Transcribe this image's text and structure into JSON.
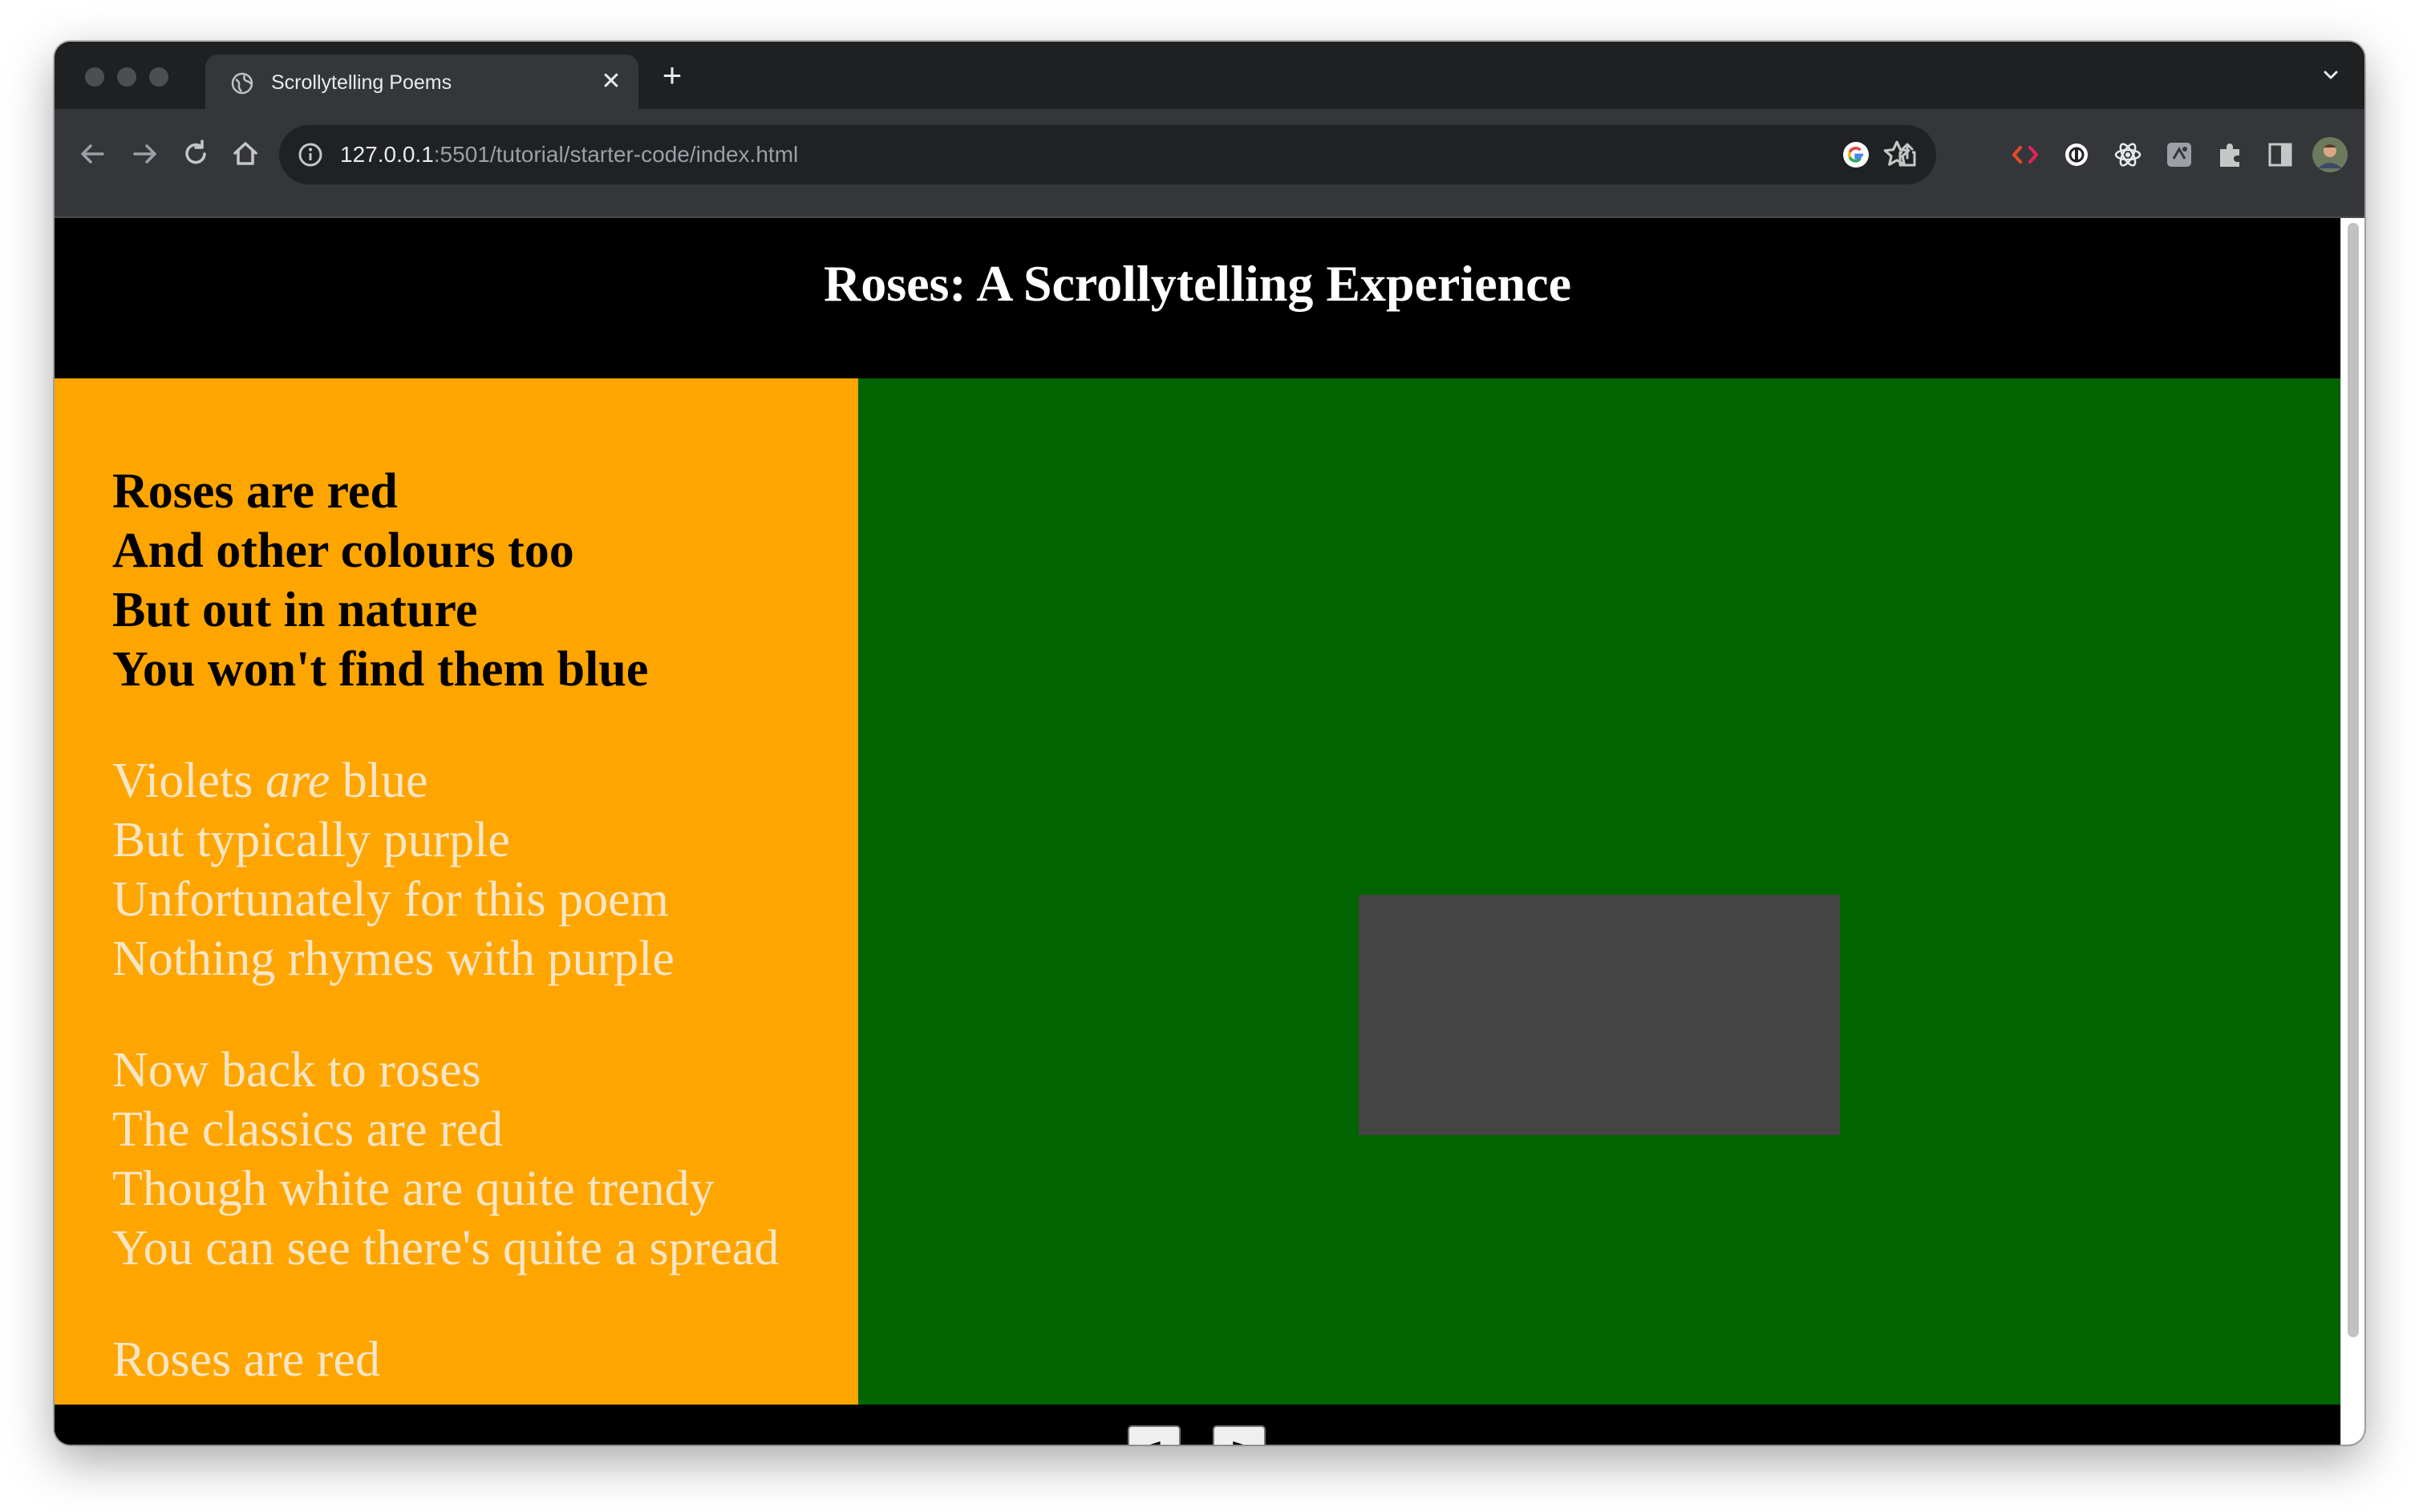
{
  "browser": {
    "tab": {
      "title": "Scrollytelling Poems",
      "close_glyph": "✕",
      "favicon": "globe-icon"
    },
    "new_tab_glyph": "+",
    "address": {
      "host": "127.0.0.1",
      "path": ":5501/tutorial/starter-code/index.html"
    },
    "toolbar_icons": [
      "back-icon",
      "forward-icon",
      "reload-icon",
      "home-icon",
      "site-info-icon",
      "google-icon",
      "share-icon",
      "bookmark-star-icon"
    ],
    "extension_icons": [
      "code-brackets-extension-icon",
      "circle-extension-icon",
      "react-devtools-icon",
      "square-extension-icon",
      "puzzle-extensions-icon",
      "side-panel-icon",
      "profile-avatar",
      "kebab-menu-icon"
    ]
  },
  "page": {
    "title": "Roses: A Scrollytelling Experience",
    "colors": {
      "header_bg": "#000000",
      "poem_panel_bg": "#ffa500",
      "viz_panel_bg": "#006400",
      "viz_rect": "#444444",
      "active_text": "#000000",
      "inactive_text": "#f5e6c6"
    },
    "stanzas": [
      {
        "active": true,
        "lines": [
          "Roses are red",
          "And other colours too",
          "But out in nature",
          "You won't find them blue"
        ]
      },
      {
        "active": false,
        "line1_before": "Violets ",
        "line1_em": "are",
        "line1_after": " blue",
        "lines": [
          "But typically purple",
          "Unfortunately for this poem",
          "Nothing rhymes with purple"
        ]
      },
      {
        "active": false,
        "lines": [
          "Now back to roses",
          "The classics are red",
          "Though white are quite trendy",
          "You can see there's quite a spread"
        ]
      },
      {
        "active": false,
        "lines": [
          "Roses are red"
        ]
      }
    ],
    "controls": {
      "prev_label": "◄",
      "next_label": "►"
    }
  }
}
